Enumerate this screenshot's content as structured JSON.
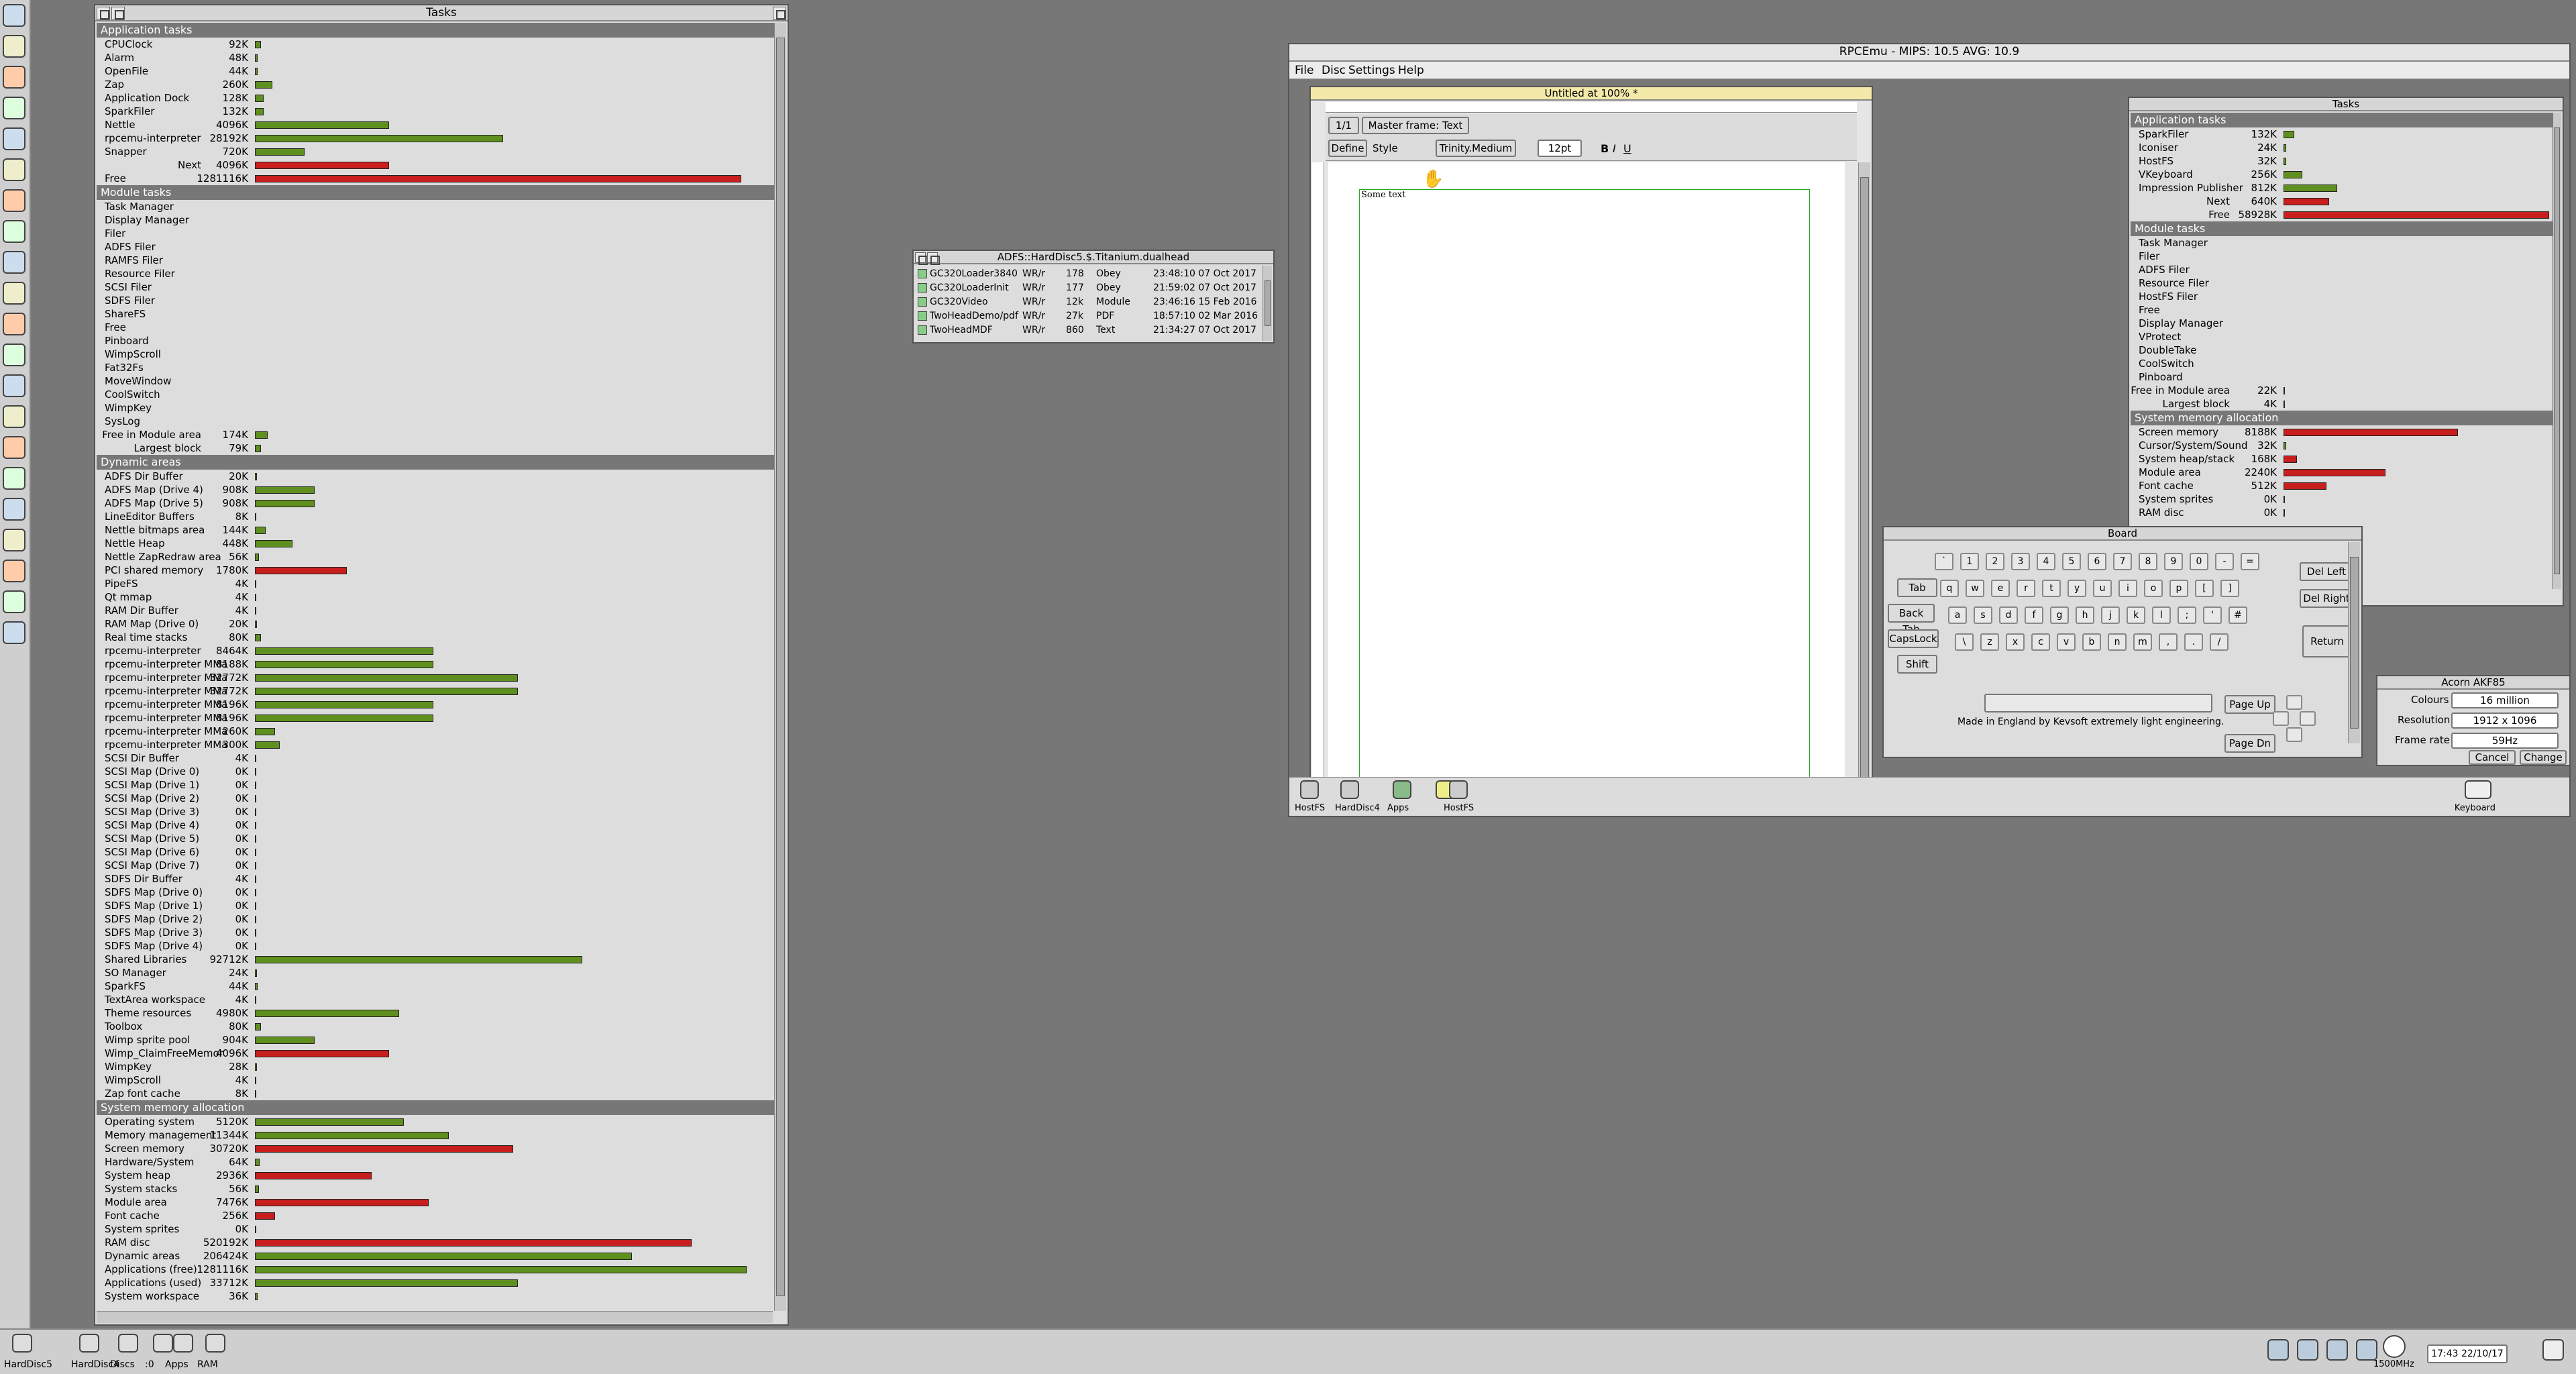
{
  "iconbar_left": [
    "rpcemu",
    "paint",
    "bug",
    "notepad",
    "monitor",
    "network",
    "security",
    "display",
    "chart",
    "edit",
    "eye",
    "alarm",
    "globe",
    "search",
    "draw",
    "puzzle",
    "firefox",
    "star",
    "browser",
    "tux",
    "snake"
  ],
  "tasks_main": {
    "title": "Tasks",
    "app_header": "Application tasks",
    "app": [
      {
        "label": "CPUClock",
        "value": "92K",
        "frac": 0.012,
        "color": "g"
      },
      {
        "label": "Alarm",
        "value": "48K",
        "frac": 0.006,
        "color": "g"
      },
      {
        "label": "OpenFile",
        "value": "44K",
        "frac": 0.006,
        "color": "g"
      },
      {
        "label": "Zap",
        "value": "260K",
        "frac": 0.035,
        "color": "g"
      },
      {
        "label": "Application Dock",
        "value": "128K",
        "frac": 0.017,
        "color": "g"
      },
      {
        "label": "SparkFiler",
        "value": "132K",
        "frac": 0.018,
        "color": "g"
      },
      {
        "label": "Nettle",
        "value": "4096K",
        "frac": 0.27,
        "color": "g"
      },
      {
        "label": "rpcemu-interpreter",
        "value": "28192K",
        "frac": 0.5,
        "color": "g"
      },
      {
        "label": "Snapper",
        "value": "720K",
        "frac": 0.1,
        "color": "g"
      },
      {
        "label": "Next",
        "value": "4096K",
        "frac": 0.27,
        "color": "r",
        "indent": "ind2"
      },
      {
        "label": "Free",
        "value": "1281116K",
        "frac": 0.98,
        "color": "r",
        "indent": "ind2b"
      }
    ],
    "mod_header": "Module tasks",
    "mod": [
      "Task Manager",
      "Display Manager",
      "Filer",
      "ADFS Filer",
      "RAMFS Filer",
      "Resource Filer",
      "SCSI Filer",
      "SDFS Filer",
      "ShareFS",
      "Free",
      "Pinboard",
      "WimpScroll",
      "Fat32Fs",
      "MoveWindow",
      "CoolSwitch",
      "WimpKey",
      "SysLog"
    ],
    "mod_free": [
      {
        "label": "Free in Module area",
        "value": "174K",
        "frac": 0.025
      },
      {
        "label": "Largest block",
        "value": "79K",
        "frac": 0.012
      }
    ],
    "dyn_header": "Dynamic areas",
    "dyn": [
      {
        "label": "ADFS Dir Buffer",
        "value": "20K",
        "frac": 0.004,
        "color": "g"
      },
      {
        "label": "ADFS Map (Drive 4)",
        "value": "908K",
        "frac": 0.12,
        "color": "g"
      },
      {
        "label": "ADFS Map (Drive 5)",
        "value": "908K",
        "frac": 0.12,
        "color": "g"
      },
      {
        "label": "LineEditor Buffers",
        "value": "8K",
        "frac": 0.003,
        "color": "g"
      },
      {
        "label": "Nettle bitmaps area",
        "value": "144K",
        "frac": 0.022,
        "color": "g"
      },
      {
        "label": "Nettle Heap",
        "value": "448K",
        "frac": 0.075,
        "color": "g"
      },
      {
        "label": "Nettle ZapRedraw area",
        "value": "56K",
        "frac": 0.008,
        "color": "g"
      },
      {
        "label": "PCI shared memory",
        "value": "1780K",
        "frac": 0.185,
        "color": "r"
      },
      {
        "label": "PipeFS",
        "value": "4K",
        "frac": 0.003,
        "color": "g"
      },
      {
        "label": "Qt mmap",
        "value": "4K",
        "frac": 0.003,
        "color": "g"
      },
      {
        "label": "RAM Dir Buffer",
        "value": "4K",
        "frac": 0.003,
        "color": "g"
      },
      {
        "label": "RAM Map (Drive 0)",
        "value": "20K",
        "frac": 0.004,
        "color": "g"
      },
      {
        "label": "Real time stacks",
        "value": "80K",
        "frac": 0.012,
        "color": "g"
      },
      {
        "label": "rpcemu-interpreter",
        "value": "8464K",
        "frac": 0.36,
        "color": "g"
      },
      {
        "label": "rpcemu-interpreter MMa",
        "value": "8188K",
        "frac": 0.36,
        "color": "g"
      },
      {
        "label": "rpcemu-interpreter MMa",
        "value": "32772K",
        "frac": 0.53,
        "color": "g"
      },
      {
        "label": "rpcemu-interpreter MMa",
        "value": "32772K",
        "frac": 0.53,
        "color": "g"
      },
      {
        "label": "rpcemu-interpreter MMa",
        "value": "8196K",
        "frac": 0.36,
        "color": "g"
      },
      {
        "label": "rpcemu-interpreter MMa",
        "value": "8196K",
        "frac": 0.36,
        "color": "g"
      },
      {
        "label": "rpcemu-interpreter MMa",
        "value": "260K",
        "frac": 0.04,
        "color": "g"
      },
      {
        "label": "rpcemu-interpreter MMa",
        "value": "300K",
        "frac": 0.05,
        "color": "g"
      },
      {
        "label": "SCSI Dir Buffer",
        "value": "4K",
        "frac": 0.003,
        "color": "g"
      },
      {
        "label": "SCSI Map (Drive 0)",
        "value": "0K",
        "frac": 0,
        "color": "g"
      },
      {
        "label": "SCSI Map (Drive 1)",
        "value": "0K",
        "frac": 0,
        "color": "g"
      },
      {
        "label": "SCSI Map (Drive 2)",
        "value": "0K",
        "frac": 0,
        "color": "g"
      },
      {
        "label": "SCSI Map (Drive 3)",
        "value": "0K",
        "frac": 0,
        "color": "g"
      },
      {
        "label": "SCSI Map (Drive 4)",
        "value": "0K",
        "frac": 0,
        "color": "g"
      },
      {
        "label": "SCSI Map (Drive 5)",
        "value": "0K",
        "frac": 0,
        "color": "g"
      },
      {
        "label": "SCSI Map (Drive 6)",
        "value": "0K",
        "frac": 0,
        "color": "g"
      },
      {
        "label": "SCSI Map (Drive 7)",
        "value": "0K",
        "frac": 0,
        "color": "g"
      },
      {
        "label": "SDFS Dir Buffer",
        "value": "4K",
        "frac": 0.003,
        "color": "g"
      },
      {
        "label": "SDFS Map (Drive 0)",
        "value": "0K",
        "frac": 0,
        "color": "g"
      },
      {
        "label": "SDFS Map (Drive 1)",
        "value": "0K",
        "frac": 0,
        "color": "g"
      },
      {
        "label": "SDFS Map (Drive 2)",
        "value": "0K",
        "frac": 0,
        "color": "g"
      },
      {
        "label": "SDFS Map (Drive 3)",
        "value": "0K",
        "frac": 0,
        "color": "g"
      },
      {
        "label": "SDFS Map (Drive 4)",
        "value": "0K",
        "frac": 0,
        "color": "g"
      },
      {
        "label": "Shared Libraries",
        "value": "92712K",
        "frac": 0.66,
        "color": "g"
      },
      {
        "label": "SO Manager",
        "value": "24K",
        "frac": 0.004,
        "color": "g"
      },
      {
        "label": "SparkFS",
        "value": "44K",
        "frac": 0.006,
        "color": "g"
      },
      {
        "label": "TextArea workspace",
        "value": "4K",
        "frac": 0.003,
        "color": "g"
      },
      {
        "label": "Theme resources",
        "value": "4980K",
        "frac": 0.29,
        "color": "g"
      },
      {
        "label": "Toolbox",
        "value": "80K",
        "frac": 0.012,
        "color": "g"
      },
      {
        "label": "Wimp sprite pool",
        "value": "904K",
        "frac": 0.12,
        "color": "g"
      },
      {
        "label": "Wimp_ClaimFreeMemor",
        "value": "4096K",
        "frac": 0.27,
        "color": "r"
      },
      {
        "label": "WimpKey",
        "value": "28K",
        "frac": 0.004,
        "color": "g"
      },
      {
        "label": "WimpScroll",
        "value": "4K",
        "frac": 0.003,
        "color": "g"
      },
      {
        "label": "Zap font cache",
        "value": "8K",
        "frac": 0.003,
        "color": "g"
      }
    ],
    "sys_header": "System memory allocation",
    "sys": [
      {
        "label": "Operating system",
        "value": "5120K",
        "frac": 0.3,
        "color": "g"
      },
      {
        "label": "Memory management",
        "value": "11344K",
        "frac": 0.39,
        "color": "g"
      },
      {
        "label": "Screen memory",
        "value": "30720K",
        "frac": 0.52,
        "color": "r"
      },
      {
        "label": "Hardware/System",
        "value": "64K",
        "frac": 0.01,
        "color": "g"
      },
      {
        "label": "System heap",
        "value": "2936K",
        "frac": 0.235,
        "color": "r"
      },
      {
        "label": "System stacks",
        "value": "56K",
        "frac": 0.008,
        "color": "g"
      },
      {
        "label": "Module area",
        "value": "7476K",
        "frac": 0.35,
        "color": "r"
      },
      {
        "label": "Font cache",
        "value": "256K",
        "frac": 0.04,
        "color": "r"
      },
      {
        "label": "System sprites",
        "value": "0K",
        "frac": 0,
        "color": "g"
      },
      {
        "label": "RAM disc",
        "value": "520192K",
        "frac": 0.88,
        "color": "r"
      },
      {
        "label": "Dynamic areas",
        "value": "206424K",
        "frac": 0.76,
        "color": "g"
      },
      {
        "label": "Applications (free)",
        "value": "1281116K",
        "frac": 0.99,
        "color": "g"
      },
      {
        "label": "Applications (used)",
        "value": "33712K",
        "frac": 0.53,
        "color": "g"
      },
      {
        "label": "System workspace",
        "value": "36K",
        "frac": 0.006,
        "color": "g"
      }
    ]
  },
  "filer": {
    "title": "ADFS::HardDisc5.$.Titanium.dualhead",
    "files": [
      {
        "name": "GC320Loader3840",
        "access": "WR/r",
        "size": "178",
        "type": "Obey",
        "date": "23:48:10 07 Oct 2017"
      },
      {
        "name": "GC320LoaderInit",
        "access": "WR/r",
        "size": "177",
        "type": "Obey",
        "date": "21:59:02 07 Oct 2017"
      },
      {
        "name": "GC320Video",
        "access": "WR/r",
        "size": "12k",
        "type": "Module",
        "date": "23:46:16 15 Feb 2016"
      },
      {
        "name": "TwoHeadDemo/pdf",
        "access": "WR/r",
        "size": "27k",
        "type": "PDF",
        "date": "18:57:10 02 Mar 2016"
      },
      {
        "name": "TwoHeadMDF",
        "access": "WR/r",
        "size": "860",
        "type": "Text",
        "date": "21:34:27 07 Oct 2017"
      }
    ]
  },
  "rpcemu": {
    "title": "RPCEmu - MIPS: 10.5 AVG: 10.9",
    "menu": [
      "File",
      "Disc",
      "Settings",
      "Help"
    ],
    "iconbar": [
      "HostFS",
      "HardDisc4",
      "Apps",
      "",
      "HostFS"
    ],
    "iconbar_right": "Keyboard"
  },
  "impression": {
    "title": "Untitled at 100% *",
    "page": "1/1",
    "frame": "Master frame: Text",
    "define": "Define",
    "style": "Style",
    "font": "Trinity.Medium",
    "size": "12pt",
    "text": "Some text"
  },
  "tasks_small": {
    "title": "Tasks",
    "app_header": "Application tasks",
    "app": [
      {
        "label": "SparkFiler",
        "value": "132K",
        "frac": 0.04,
        "color": "g"
      },
      {
        "label": "Iconiser",
        "value": "24K",
        "frac": 0.01,
        "color": "g"
      },
      {
        "label": "HostFS",
        "value": "32K",
        "frac": 0.01,
        "color": "g"
      },
      {
        "label": "VKeyboard",
        "value": "256K",
        "frac": 0.07,
        "color": "g"
      },
      {
        "label": "Impression Publisher",
        "value": "812K",
        "frac": 0.2,
        "color": "g"
      },
      {
        "label": "Next",
        "value": "640K",
        "frac": 0.17,
        "color": "r",
        "rj": true
      },
      {
        "label": "Free",
        "value": "58928K",
        "frac": 0.99,
        "color": "r",
        "rj": true
      }
    ],
    "mod_header": "Module tasks",
    "mod": [
      "Task Manager",
      "Filer",
      "ADFS Filer",
      "Resource Filer",
      "HostFS Filer",
      "Free",
      "Display Manager",
      "VProtect",
      "DoubleTake",
      "CoolSwitch",
      "Pinboard"
    ],
    "mod_free": [
      {
        "label": "Free in Module area",
        "value": "22K",
        "frac": 0.005
      },
      {
        "label": "Largest block",
        "value": "4K",
        "frac": 0.002
      }
    ],
    "sys_header": "System memory allocation",
    "sys": [
      {
        "label": "Screen memory",
        "value": "8188K",
        "frac": 0.65,
        "color": "r"
      },
      {
        "label": "Cursor/System/Sound",
        "value": "32K",
        "frac": 0.01,
        "color": "g"
      },
      {
        "label": "System heap/stack",
        "value": "168K",
        "frac": 0.05,
        "color": "r"
      },
      {
        "label": "Module area",
        "value": "2240K",
        "frac": 0.38,
        "color": "r"
      },
      {
        "label": "Font cache",
        "value": "512K",
        "frac": 0.16,
        "color": "r"
      },
      {
        "label": "System sprites",
        "value": "0K",
        "frac": 0,
        "color": "g"
      },
      {
        "label": "RAM disc",
        "value": "0K",
        "frac": 0,
        "color": "g"
      }
    ]
  },
  "board": {
    "title": "Board",
    "row1": [
      "`",
      "1",
      "2",
      "3",
      "4",
      "5",
      "6",
      "7",
      "8",
      "9",
      "0",
      "-",
      "="
    ],
    "row2": [
      "q",
      "w",
      "e",
      "r",
      "t",
      "y",
      "u",
      "i",
      "o",
      "p",
      "[",
      "]"
    ],
    "row3": [
      "a",
      "s",
      "d",
      "f",
      "g",
      "h",
      "j",
      "k",
      "l",
      ";",
      "'",
      "#"
    ],
    "row4": [
      "\\",
      "z",
      "x",
      "c",
      "v",
      "b",
      "n",
      "m",
      ",",
      ".",
      "/"
    ],
    "tab": "Tab",
    "backtab": "Back Tab",
    "capslock": "CapsLock",
    "shift": "Shift",
    "delleft": "Del Left",
    "delright": "Del Right",
    "return": "Return",
    "pageup": "Page Up",
    "pagedn": "Page Dn",
    "credit": "Made in England by Kevsoft extremely light engineering."
  },
  "akf": {
    "title": "Acorn AKF85",
    "colours_label": "Colours",
    "colours": "16 million",
    "resolution_label": "Resolution",
    "resolution": "1912 x 1096",
    "framerate_label": "Frame rate",
    "framerate": "59Hz",
    "cancel": "Cancel",
    "change": "Change"
  },
  "bottom_bar": {
    "left": [
      "HardDisc5",
      "HardDisc4",
      "Discs",
      ":0",
      "Apps",
      "RAM"
    ],
    "clock": "17:43 22/10/17",
    "speed": "1500MHz"
  }
}
